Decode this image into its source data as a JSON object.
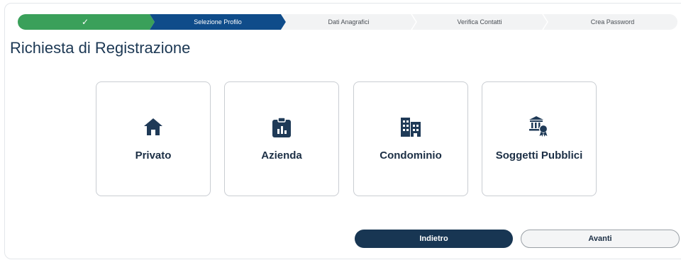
{
  "stepper": {
    "steps": [
      {
        "label": "",
        "state": "done"
      },
      {
        "label": "Selezione Profilo",
        "state": "active"
      },
      {
        "label": "Dati Anagrafici",
        "state": "todo"
      },
      {
        "label": "Verifica Contatti",
        "state": "todo"
      },
      {
        "label": "Crea Password",
        "state": "todo"
      }
    ],
    "check_icon": "check-icon"
  },
  "title": "Richiesta di Registrazione",
  "profiles": [
    {
      "label": "Privato",
      "icon": "home-icon"
    },
    {
      "label": "Azienda",
      "icon": "company-icon"
    },
    {
      "label": "Condominio",
      "icon": "building-icon"
    },
    {
      "label": "Soggetti Pubblici",
      "icon": "public-institution-icon"
    }
  ],
  "buttons": {
    "back": "Indietro",
    "next": "Avanti"
  },
  "colors": {
    "done": "#3aa05a",
    "active": "#0f4c8a",
    "todo": "#f2f3f4",
    "primary": "#183653"
  }
}
